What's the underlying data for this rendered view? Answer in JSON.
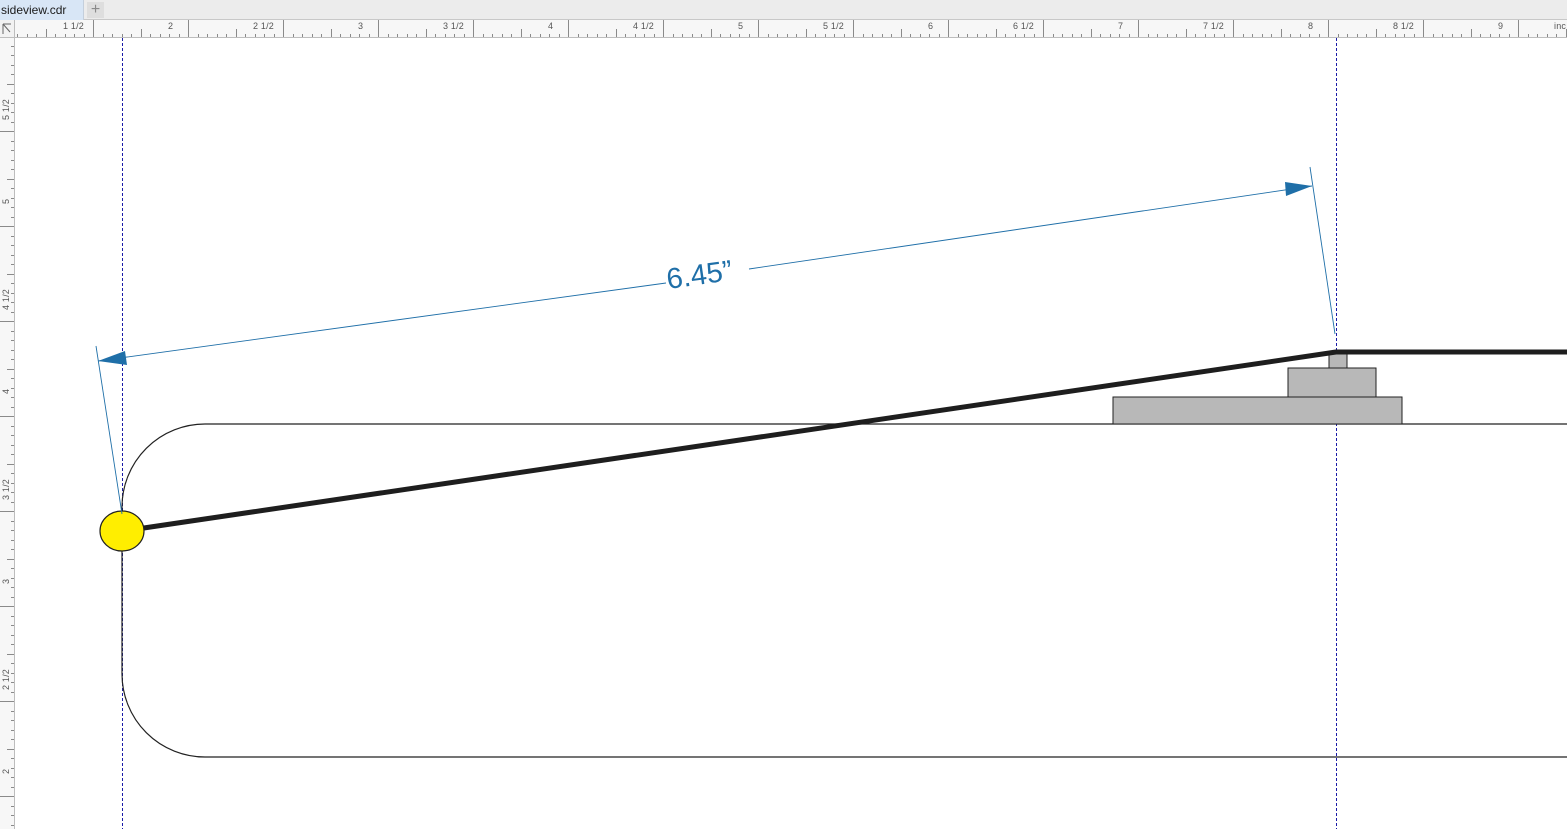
{
  "document": {
    "tab_label": "sideview.cdr",
    "new_tab_symbol": "+"
  },
  "ruler": {
    "horizontal_labels": [
      "1 1/2",
      "2",
      "2 1/2",
      "3",
      "3 1/2",
      "4",
      "4 1/2",
      "5",
      "5 1/2",
      "6",
      "6 1/2",
      "7",
      "7 1/2",
      "8",
      "8 1/2",
      "9",
      "inc"
    ],
    "vertical_labels": [
      "5 1/2",
      "5",
      "4 1/2",
      "4",
      "3 1/2",
      "3",
      "2 1/2",
      "2"
    ]
  },
  "drawing": {
    "dimension_label": "6.45”",
    "colors": {
      "dimension": "#1f6fa8",
      "guide": "#1a1aa8",
      "rod": "#1e1e1e",
      "pivot": "#ffee00",
      "block": "#b8b8b8",
      "outline": "#222222"
    }
  }
}
